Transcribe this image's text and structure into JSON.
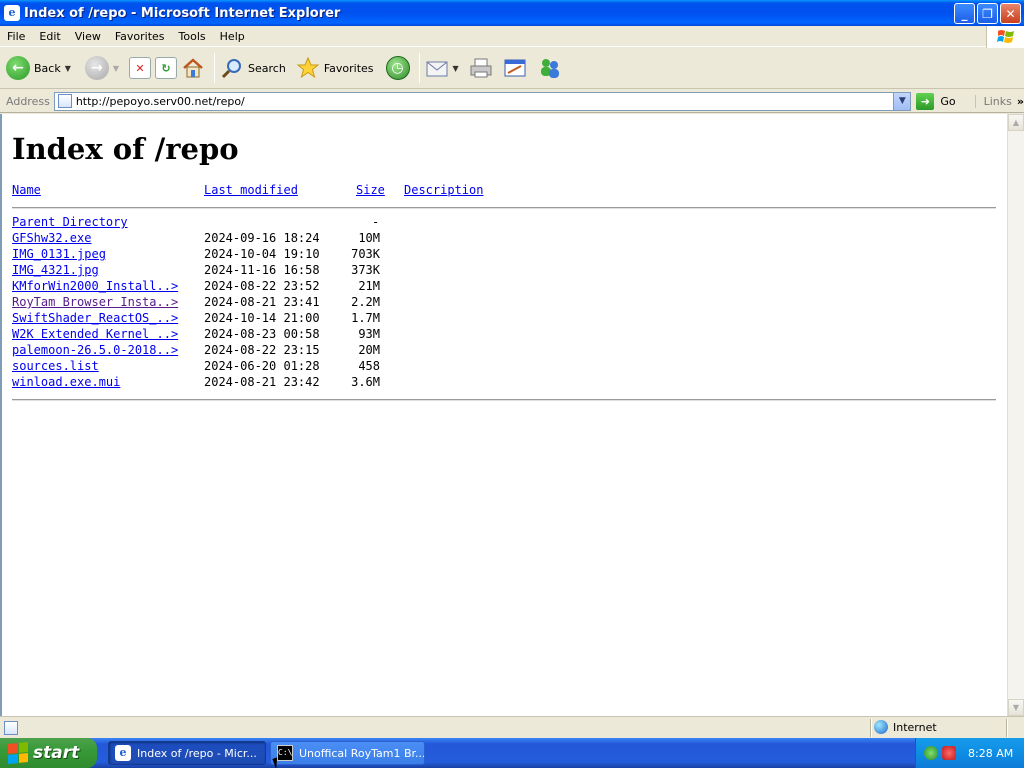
{
  "window": {
    "title": "Index of /repo - Microsoft Internet Explorer",
    "minimize": "_",
    "maximize": "❐",
    "close": "✕"
  },
  "menu": [
    "File",
    "Edit",
    "View",
    "Favorites",
    "Tools",
    "Help"
  ],
  "toolbar": {
    "back_label": "Back",
    "search_label": "Search",
    "favorites_label": "Favorites"
  },
  "address": {
    "label": "Address",
    "url": "http://pepoyo.serv00.net/repo/",
    "go_label": "Go",
    "links_label": "Links"
  },
  "page": {
    "heading": "Index of /repo",
    "columns": {
      "name": "Name",
      "last_modified": "Last modified",
      "size": "Size",
      "description": "Description"
    },
    "parent": {
      "name": "Parent Directory",
      "size": "-"
    },
    "rows": [
      {
        "name": "GFShw32.exe",
        "modified": "2024-09-16 18:24",
        "size": "10M",
        "visited": false
      },
      {
        "name": "IMG_0131.jpeg",
        "modified": "2024-10-04 19:10",
        "size": "703K",
        "visited": false
      },
      {
        "name": "IMG_4321.jpg",
        "modified": "2024-11-16 16:58",
        "size": "373K",
        "visited": false
      },
      {
        "name": "KMforWin2000_Install..>",
        "modified": "2024-08-22 23:52",
        "size": "21M",
        "visited": false
      },
      {
        "name": "RoyTam Browser Insta..>",
        "modified": "2024-08-21 23:41",
        "size": "2.2M",
        "visited": true
      },
      {
        "name": "SwiftShader_ReactOS_..>",
        "modified": "2024-10-14 21:00",
        "size": "1.7M",
        "visited": false
      },
      {
        "name": "W2K Extended Kernel ..>",
        "modified": "2024-08-23 00:58",
        "size": "93M",
        "visited": false
      },
      {
        "name": "palemoon-26.5.0-2018..>",
        "modified": "2024-08-22 23:15",
        "size": "20M",
        "visited": false
      },
      {
        "name": "sources.list",
        "modified": "2024-06-20 01:28",
        "size": "458",
        "visited": false
      },
      {
        "name": "winload.exe.mui",
        "modified": "2024-08-21 23:42",
        "size": "3.6M",
        "visited": false
      }
    ]
  },
  "status": {
    "zone": "Internet"
  },
  "taskbar": {
    "start": "start",
    "tasks": [
      {
        "label": "Index of /repo - Micr..."
      },
      {
        "label": "Unoffical RoyTam1 Br..."
      }
    ],
    "clock": "8:28 AM"
  },
  "colors": {
    "link": "#0000ee",
    "visited_link": "#551a8b",
    "titlebar": "#0050ee",
    "taskbar": "#245ddb",
    "start_green": "#379a37"
  }
}
